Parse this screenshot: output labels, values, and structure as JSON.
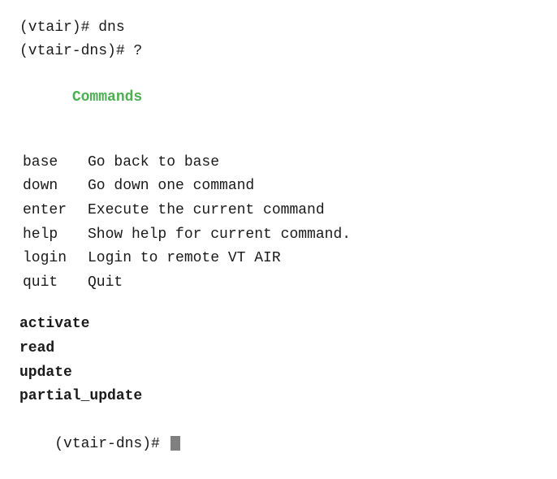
{
  "terminal": {
    "line1": "(vtair)# dns",
    "line2": "(vtair-dns)# ?",
    "commands_label": "Commands",
    "commands": [
      {
        "name": "base",
        "desc": "Go back to base"
      },
      {
        "name": "down",
        "desc": "Go down one command"
      },
      {
        "name": "enter",
        "desc": "Execute the current command"
      },
      {
        "name": "help",
        "desc": "Show help for current command."
      },
      {
        "name": "login",
        "desc": "Login to remote VT AIR"
      },
      {
        "name": "quit",
        "desc": "Quit"
      }
    ],
    "bold_commands": [
      "activate",
      "read",
      "update",
      "partial_update"
    ],
    "prompt": "(vtair-dns)# "
  }
}
